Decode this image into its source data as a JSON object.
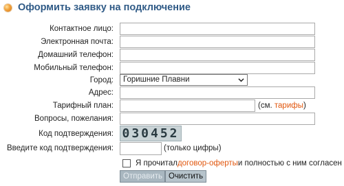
{
  "header": {
    "title": "Оформить заявку на подключение"
  },
  "form": {
    "contact_label": "Контактное лицо:",
    "email_label": "Электронная почта:",
    "home_phone_label": "Домашний телефон:",
    "mobile_phone_label": "Мобильный телефон:",
    "city_label": "Город:",
    "city_value": "Горишние Плавни",
    "address_label": "Адрес:",
    "tariff_label": "Тарифный план:",
    "tariff_note_prefix": "(см. ",
    "tariff_link": "тарифы",
    "tariff_note_suffix": ")",
    "questions_label": "Вопросы, пожелания:",
    "code_label": "Код подтверждения:",
    "captcha_text": "030452",
    "enter_code_label": "Введите код подтверждения:",
    "digits_only": "(только цифры)",
    "agree_prefix": "Я прочитал ",
    "agree_link": "договор-оферты",
    "agree_suffix": " и полностью с ним согласен"
  },
  "buttons": {
    "submit": "Отправить",
    "clear": "Очистить"
  }
}
